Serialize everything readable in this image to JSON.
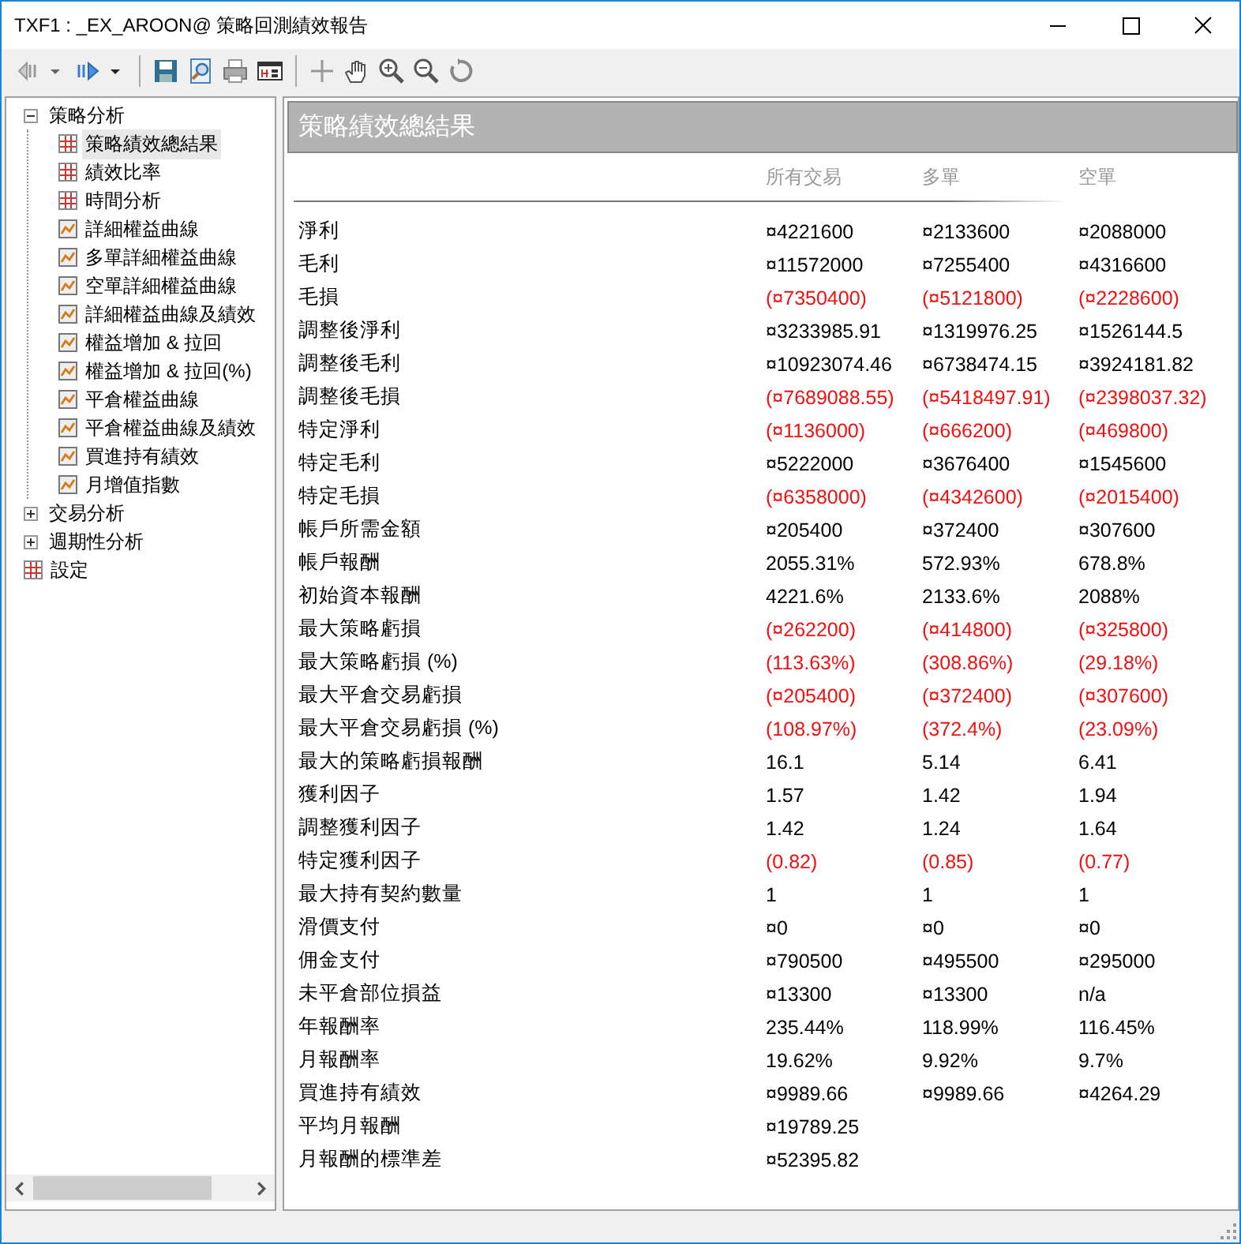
{
  "window": {
    "title": "TXF1 : _EX_AROON@ 策略回測績效報告"
  },
  "tree": [
    {
      "label": "策略分析",
      "expanded": true,
      "selected": false,
      "children": [
        {
          "label": "策略績效總結果",
          "kind": "grid",
          "selected": true
        },
        {
          "label": "績效比率",
          "kind": "grid",
          "selected": false
        },
        {
          "label": "時間分析",
          "kind": "grid",
          "selected": false
        },
        {
          "label": "詳細權益曲線",
          "kind": "chart",
          "selected": false
        },
        {
          "label": "多單詳細權益曲線",
          "kind": "chart",
          "selected": false
        },
        {
          "label": "空單詳細權益曲線",
          "kind": "chart",
          "selected": false
        },
        {
          "label": "詳細權益曲線及績效",
          "kind": "chart",
          "selected": false
        },
        {
          "label": "權益增加 & 拉回",
          "kind": "chart",
          "selected": false
        },
        {
          "label": "權益增加 & 拉回(%)",
          "kind": "chart",
          "selected": false
        },
        {
          "label": "平倉權益曲線",
          "kind": "chart",
          "selected": false
        },
        {
          "label": "平倉權益曲線及績效",
          "kind": "chart",
          "selected": false
        },
        {
          "label": "買進持有績效",
          "kind": "chart",
          "selected": false
        },
        {
          "label": "月增值指數",
          "kind": "chart",
          "selected": false
        }
      ]
    },
    {
      "label": "交易分析",
      "expanded": false,
      "selected": false
    },
    {
      "label": "週期性分析",
      "expanded": false,
      "selected": false
    },
    {
      "label": "設定",
      "kind": "grid",
      "selected": false
    }
  ],
  "report": {
    "title": "策略績效總結果",
    "columns": [
      "所有交易",
      "多單",
      "空單"
    ],
    "rows": [
      {
        "label": "淨利",
        "negative": false,
        "values": [
          "¤4221600",
          "¤2133600",
          "¤2088000"
        ]
      },
      {
        "label": "毛利",
        "negative": false,
        "values": [
          "¤11572000",
          "¤7255400",
          "¤4316600"
        ]
      },
      {
        "label": "毛損",
        "negative": true,
        "values": [
          "(¤7350400)",
          "(¤5121800)",
          "(¤2228600)"
        ]
      },
      {
        "label": "調整後淨利",
        "negative": false,
        "values": [
          "¤3233985.91",
          "¤1319976.25",
          "¤1526144.5"
        ]
      },
      {
        "label": "調整後毛利",
        "negative": false,
        "values": [
          "¤10923074.46",
          "¤6738474.15",
          "¤3924181.82"
        ]
      },
      {
        "label": "調整後毛損",
        "negative": true,
        "values": [
          "(¤7689088.55)",
          "(¤5418497.91)",
          "(¤2398037.32)"
        ]
      },
      {
        "label": "特定淨利",
        "negative": true,
        "values": [
          "(¤1136000)",
          "(¤666200)",
          "(¤469800)"
        ]
      },
      {
        "label": "特定毛利",
        "negative": false,
        "values": [
          "¤5222000",
          "¤3676400",
          "¤1545600"
        ]
      },
      {
        "label": "特定毛損",
        "negative": true,
        "values": [
          "(¤6358000)",
          "(¤4342600)",
          "(¤2015400)"
        ]
      },
      {
        "label": "帳戶所需金額",
        "negative": false,
        "values": [
          "¤205400",
          "¤372400",
          "¤307600"
        ]
      },
      {
        "label": "帳戶報酬",
        "negative": false,
        "values": [
          "2055.31%",
          "572.93%",
          "678.8%"
        ]
      },
      {
        "label": "初始資本報酬",
        "negative": false,
        "values": [
          "4221.6%",
          "2133.6%",
          "2088%"
        ]
      },
      {
        "label": "最大策略虧損",
        "negative": true,
        "values": [
          "(¤262200)",
          "(¤414800)",
          "(¤325800)"
        ]
      },
      {
        "label": "最大策略虧損 (%)",
        "negative": true,
        "values": [
          "(113.63%)",
          "(308.86%)",
          "(29.18%)"
        ]
      },
      {
        "label": "最大平倉交易虧損",
        "negative": true,
        "values": [
          "(¤205400)",
          "(¤372400)",
          "(¤307600)"
        ]
      },
      {
        "label": "最大平倉交易虧損 (%)",
        "negative": true,
        "values": [
          "(108.97%)",
          "(372.4%)",
          "(23.09%)"
        ]
      },
      {
        "label": "最大的策略虧損報酬",
        "negative": false,
        "values": [
          "16.1",
          "5.14",
          "6.41"
        ]
      },
      {
        "label": "獲利因子",
        "negative": false,
        "values": [
          "1.57",
          "1.42",
          "1.94"
        ]
      },
      {
        "label": "調整獲利因子",
        "negative": false,
        "values": [
          "1.42",
          "1.24",
          "1.64"
        ]
      },
      {
        "label": "特定獲利因子",
        "negative": true,
        "values": [
          "(0.82)",
          "(0.85)",
          "(0.77)"
        ]
      },
      {
        "label": "最大持有契約數量",
        "negative": false,
        "values": [
          "1",
          "1",
          "1"
        ]
      },
      {
        "label": "滑價支付",
        "negative": false,
        "values": [
          "¤0",
          "¤0",
          "¤0"
        ]
      },
      {
        "label": "佣金支付",
        "negative": false,
        "values": [
          "¤790500",
          "¤495500",
          "¤295000"
        ]
      },
      {
        "label": "未平倉部位損益",
        "negative": false,
        "values": [
          "¤13300",
          "¤13300",
          "n/a"
        ]
      },
      {
        "label": "年報酬率",
        "negative": false,
        "values": [
          "235.44%",
          "118.99%",
          "116.45%"
        ]
      },
      {
        "label": "月報酬率",
        "negative": false,
        "values": [
          "19.62%",
          "9.92%",
          "9.7%"
        ]
      },
      {
        "label": "買進持有績效",
        "negative": false,
        "values": [
          "¤9989.66",
          "¤9989.66",
          "¤4264.29"
        ]
      },
      {
        "label": "平均月報酬",
        "negative": false,
        "values": [
          "¤19789.25"
        ]
      },
      {
        "label": "月報酬的標準差",
        "negative": false,
        "values": [
          "¤52395.82"
        ]
      }
    ]
  }
}
